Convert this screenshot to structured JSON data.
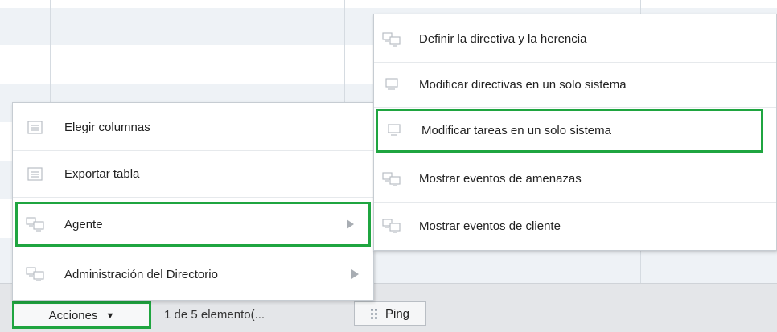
{
  "toolbar": {
    "actions_label": "Acciones",
    "count_label": "1 de 5 elemento(...",
    "ping_label": "Ping"
  },
  "actions_menu": {
    "items": [
      {
        "label": "Elegir columnas",
        "icon": "list-icon"
      },
      {
        "label": "Exportar tabla",
        "icon": "list-icon"
      },
      {
        "label": "Agente",
        "icon": "computers-icon",
        "has_submenu": true,
        "highlighted": true
      },
      {
        "label": "Administración del Directorio",
        "icon": "computers-icon",
        "has_submenu": true
      }
    ]
  },
  "agent_submenu": {
    "items": [
      {
        "label": "Definir la directiva y la herencia",
        "icon": "computers-icon"
      },
      {
        "label": "Modificar directivas en un solo sistema",
        "icon": "computer-icon"
      },
      {
        "label": "Modificar tareas en un solo sistema",
        "icon": "computer-icon",
        "highlighted": true
      },
      {
        "label": "Mostrar eventos de amenazas",
        "icon": "computers-icon"
      },
      {
        "label": "Mostrar eventos de cliente",
        "icon": "computers-icon"
      }
    ]
  },
  "colors": {
    "highlight": "#1fa540",
    "row_alt": "#eef2f6",
    "toolbar": "#e4e6e9"
  }
}
